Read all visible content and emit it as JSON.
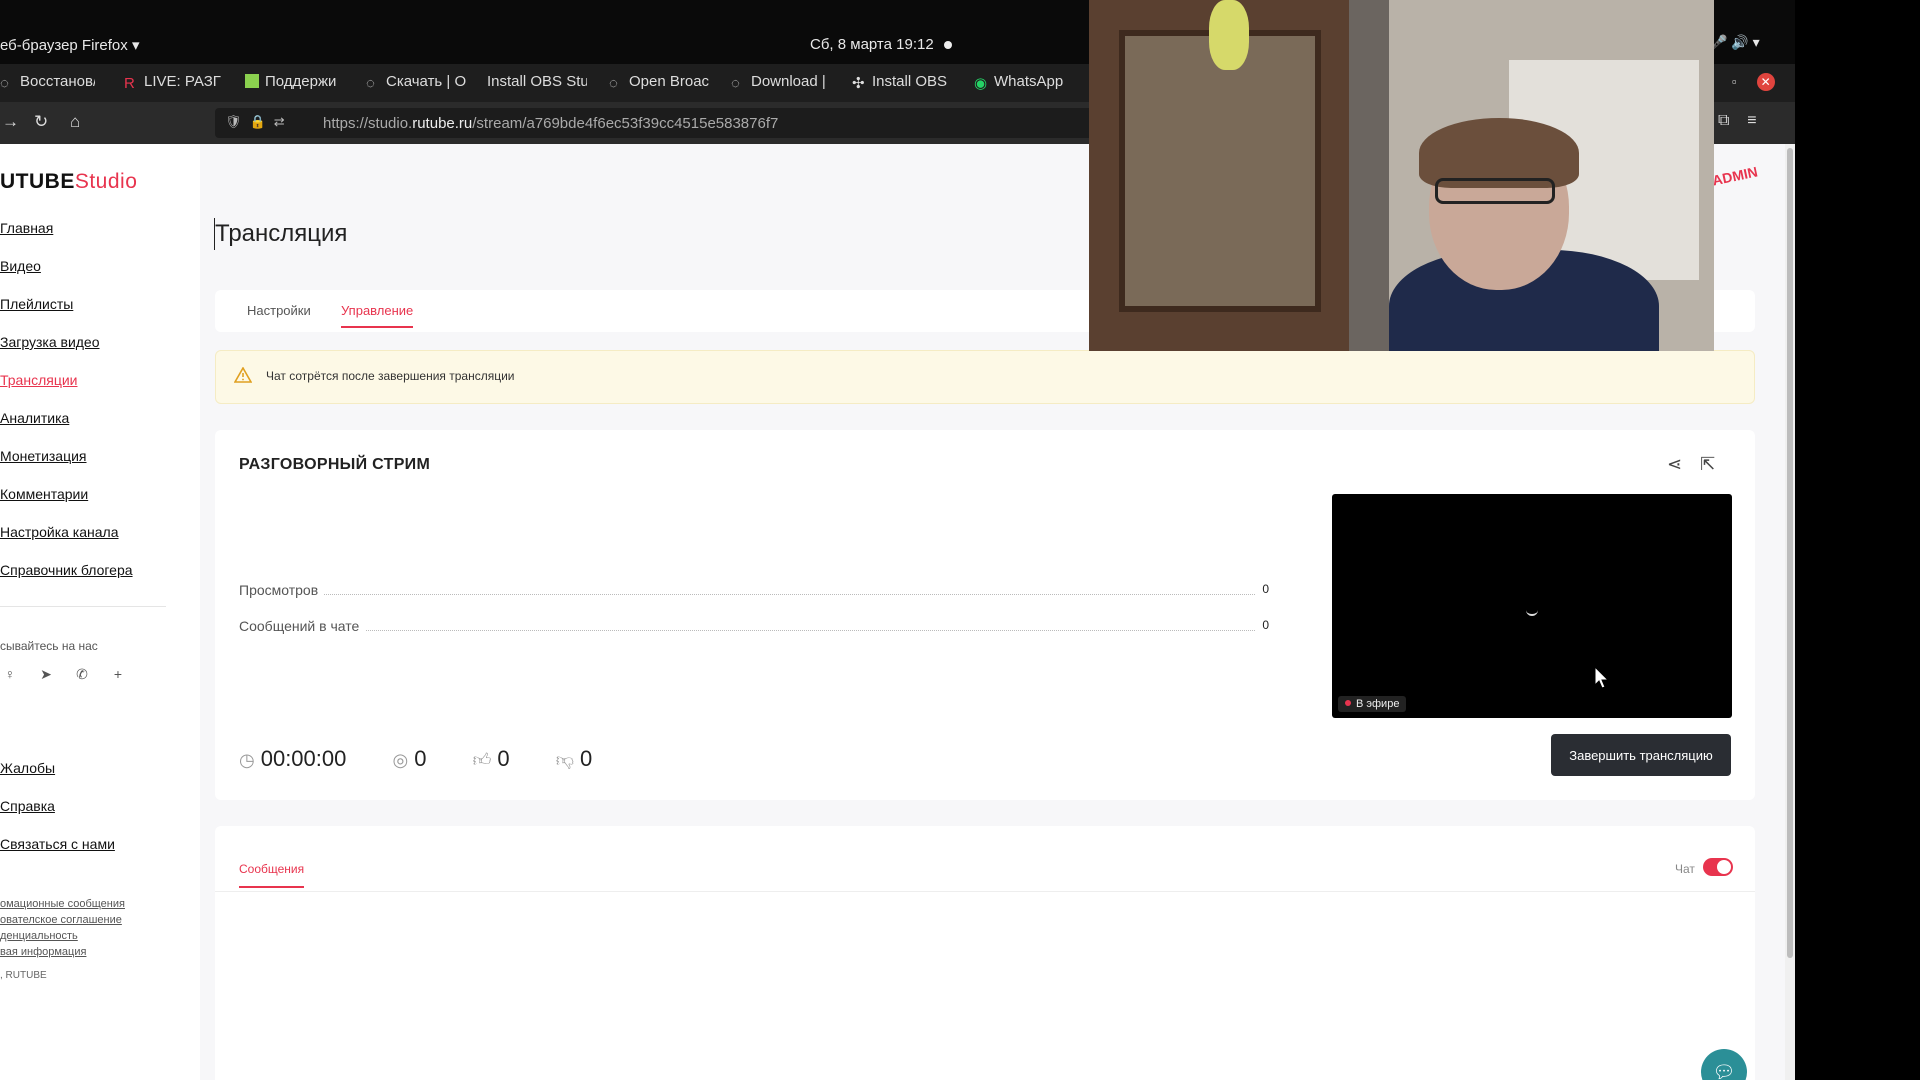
{
  "os": {
    "app_menu": "еб-браузер Firefox ▾",
    "clock": "Сб, 8 марта  19:12",
    "tray": "🎤  🔊 ▾"
  },
  "browser": {
    "tabs": [
      {
        "label": "Восстанов/",
        "icon": "restore-icon",
        "color": "#888888"
      },
      {
        "label": "LIVE: РАЗГ",
        "icon": "rutube-icon",
        "color": "#e8344e"
      },
      {
        "label": "Поддержи",
        "icon": "page-icon",
        "color": "#8bd14f"
      },
      {
        "label": "Скачать | О",
        "icon": "globe-icon",
        "color": "#888888"
      },
      {
        "label": "Install OBS Stu",
        "icon": "none",
        "color": "#888888"
      },
      {
        "label": "Open Broac",
        "icon": "globe-icon",
        "color": "#888888"
      },
      {
        "label": "Download |",
        "icon": "globe-icon",
        "color": "#888888"
      },
      {
        "label": "Install OBS",
        "icon": "slack-icon",
        "color": "#cccccc"
      },
      {
        "label": "WhatsApp",
        "icon": "whatsapp-icon",
        "color": "#25d366"
      }
    ],
    "url_prefix": "https://studio.",
    "url_host": "rutube.ru",
    "url_path": "/stream/a769bde4f6ec53f39cc4515e583876f7"
  },
  "sidebar": {
    "logo_main": "UTUBE",
    "logo_sub": "Studio",
    "menu": [
      {
        "label": "Главная",
        "active": false
      },
      {
        "label": "Видео",
        "active": false
      },
      {
        "label": "Плейлисты",
        "active": false
      },
      {
        "label": "Загрузка видео",
        "active": false
      },
      {
        "label": "Трансляции",
        "active": true
      },
      {
        "label": "Аналитика",
        "active": false
      },
      {
        "label": "Монетизация",
        "active": false
      },
      {
        "label": "Комментарии",
        "active": false
      },
      {
        "label": "Настройка канала",
        "active": false
      },
      {
        "label": "Справочник блогера",
        "active": false
      }
    ],
    "subscribe_text": "сывайтесь на нас",
    "menu2": [
      "Жалобы",
      "Справка",
      "Связаться с нами"
    ],
    "legal": [
      "омационные сообщения",
      "ователское соглашение",
      "денциальность",
      "вая информация"
    ],
    "copyright": ", RUTUBE"
  },
  "main": {
    "page_title": "Трансляция",
    "tabs": [
      "Настройки",
      "Управление"
    ],
    "active_tab": "Управление",
    "warning": "Чат сотрётся после завершения трансляции",
    "stream_title": "РАЗГОВОРНЫЙ СТРИМ",
    "stats": [
      {
        "label": "Просмотров",
        "value": "0"
      },
      {
        "label": "Сообщений в чате",
        "value": "0"
      }
    ],
    "counters": {
      "time": "00:00:00",
      "viewers": "0",
      "likes": "0",
      "dislikes": "0"
    },
    "live_badge": "В эфире",
    "end_button": "Завершить трансляцию",
    "messages_tab": "Сообщения",
    "chat_label": "Чат",
    "chat_enabled": true
  },
  "colors": {
    "accent": "#e8344e",
    "warning_bg": "#fdf9e6"
  }
}
